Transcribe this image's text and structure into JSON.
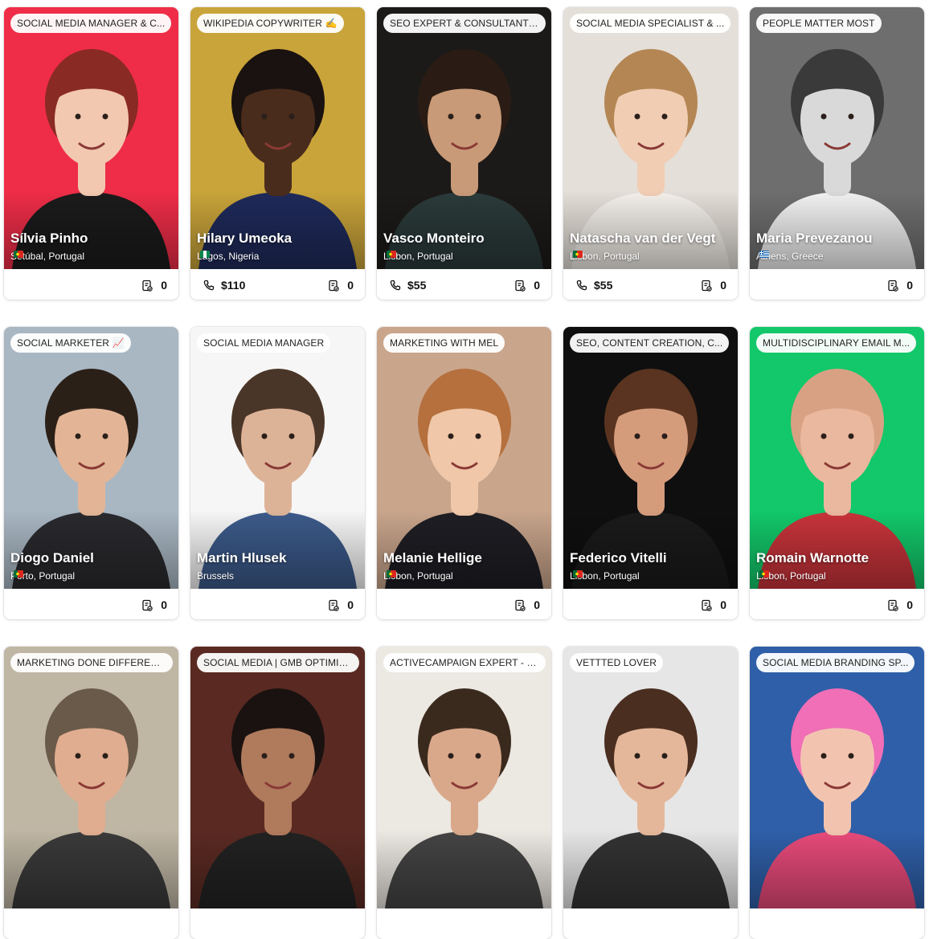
{
  "cards": [
    {
      "tagline": "SOCIAL MEDIA MANAGER & C...",
      "name": "Sílvia Pinho",
      "location": "Setúbal, Portugal",
      "flag": "pt",
      "rate": "",
      "count": "0",
      "bg": "#ef2d48",
      "skin": "#f2c8b0",
      "hair": "#8a2a24",
      "shirt": "#1b1b1b"
    },
    {
      "tagline": "WIKIPEDIA COPYWRITER ✍️",
      "name": "Hilary Umeoka",
      "location": "Lagos, Nigeria",
      "flag": "ng",
      "rate": "$110",
      "count": "0",
      "bg": "#c9a43a",
      "skin": "#4a2c1c",
      "hair": "#1a1210",
      "shirt": "#1f2a5a"
    },
    {
      "tagline": "SEO EXPERT & CONSULTANT 📈",
      "name": "Vasco Monteiro",
      "location": "Lisbon, Portugal",
      "flag": "pt",
      "rate": "$55",
      "count": "0",
      "bg": "#1c1a18",
      "skin": "#c99a78",
      "hair": "#2a1c14",
      "shirt": "#2b3a3a"
    },
    {
      "tagline": "SOCIAL MEDIA SPECIALIST & ...",
      "name": "Natascha van der Vegt",
      "location": "Lisbon, Portugal",
      "flag": "pt",
      "rate": "$55",
      "count": "0",
      "bg": "#e4dfd8",
      "skin": "#f1cdb4",
      "hair": "#b48654",
      "shirt": "#f4f0ea"
    },
    {
      "tagline": "PEOPLE MATTER MOST",
      "name": "Maria Prevezanou",
      "location": "Athens, Greece",
      "flag": "gr",
      "rate": "",
      "count": "0",
      "bg": "#6e6e6e",
      "skin": "#d9d9d9",
      "hair": "#3a3a3a",
      "shirt": "#f2f2f2"
    },
    {
      "tagline": "SOCIAL MARKETER 📈",
      "name": "Diogo Daniel",
      "location": "Porto, Portugal",
      "flag": "pt",
      "rate": "",
      "count": "0",
      "bg": "#a9b7c3",
      "skin": "#e3b596",
      "hair": "#2b2018",
      "shirt": "#2a2a2e"
    },
    {
      "tagline": "SOCIAL MEDIA MANAGER",
      "name": "Martin Hlusek",
      "location": "Brussels",
      "flag": "",
      "rate": "",
      "count": "0",
      "bg": "#f6f6f6",
      "skin": "#ddb398",
      "hair": "#4a3628",
      "shirt": "#3c5a8a"
    },
    {
      "tagline": "MARKETING WITH MEL",
      "name": "Melanie Hellige",
      "location": "Lisbon, Portugal",
      "flag": "pt",
      "rate": "",
      "count": "0",
      "bg": "#c9a58c",
      "skin": "#f0c7a8",
      "hair": "#b5703e",
      "shirt": "#1e1e24"
    },
    {
      "tagline": "SEO, CONTENT CREATION, C...",
      "name": "Federico Vitelli",
      "location": "Lisbon, Portugal",
      "flag": "pt",
      "rate": "",
      "count": "0",
      "bg": "#0f0f0f",
      "skin": "#d59c7c",
      "hair": "#5a3420",
      "shirt": "#1a1a1a"
    },
    {
      "tagline": "MULTIDISCIPLINARY EMAIL M...",
      "name": "Romain Warnotte",
      "location": "Lisbon, Portugal",
      "flag": "pt",
      "rate": "",
      "count": "0",
      "bg": "#12c86a",
      "skin": "#eab89e",
      "hair": "#d9a184",
      "shirt": "#c8343a"
    },
    {
      "tagline": "MARKETING DONE DIFFERENT...",
      "name": "",
      "location": "",
      "flag": "",
      "rate": "",
      "count": "",
      "bg": "#bfb6a4",
      "skin": "#e0ad90",
      "hair": "#6a5a4a",
      "shirt": "#3a3a3a"
    },
    {
      "tagline": "SOCIAL MEDIA | GMB OPTIMIZ...",
      "name": "",
      "location": "",
      "flag": "",
      "rate": "",
      "count": "",
      "bg": "#5a2a22",
      "skin": "#b07a5c",
      "hair": "#1a1210",
      "shirt": "#222"
    },
    {
      "tagline": "ACTIVECAMPAIGN EXPERT - E...",
      "name": "",
      "location": "",
      "flag": "",
      "rate": "",
      "count": "",
      "bg": "#ece8e2",
      "skin": "#d9a88a",
      "hair": "#3a2a1e",
      "shirt": "#444"
    },
    {
      "tagline": "VETTTED LOVER",
      "name": "",
      "location": "",
      "flag": "",
      "rate": "",
      "count": "",
      "bg": "#e6e6e6",
      "skin": "#e5b79a",
      "hair": "#4a2e20",
      "shirt": "#333"
    },
    {
      "tagline": "SOCIAL MEDIA BRANDING SP...",
      "name": "",
      "location": "",
      "flag": "",
      "rate": "",
      "count": "",
      "bg": "#2f5fa8",
      "skin": "#f2c4b0",
      "hair": "#f06fb6",
      "shirt": "#e84a7a"
    }
  ]
}
